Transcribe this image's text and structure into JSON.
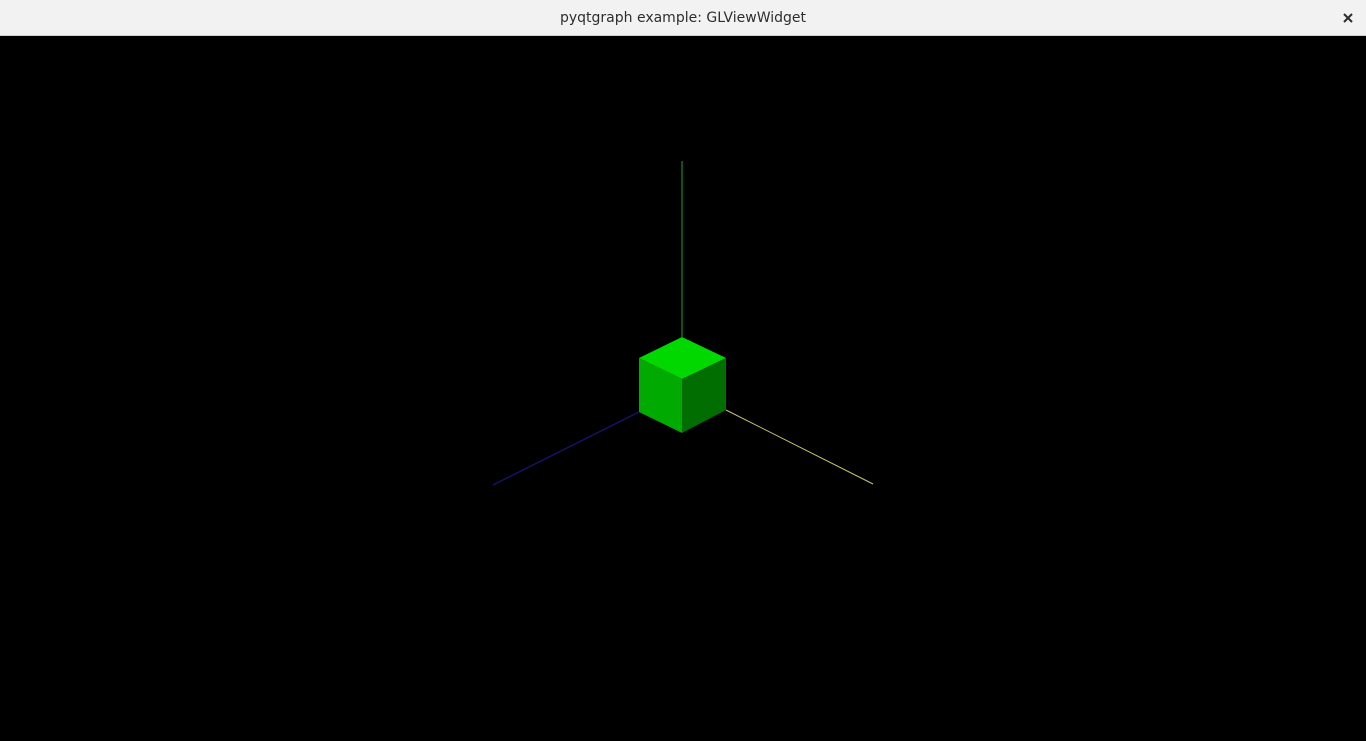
{
  "window": {
    "title": "pyqtgraph example: GLViewWidget",
    "close_icon": "close-icon"
  },
  "scene": {
    "background": "#000000",
    "axes": {
      "up_color": "#1fa01f",
      "left_color": "#14146e",
      "right_color": "#c8c86e"
    },
    "cube": {
      "top_color": "#00d800",
      "front_color": "#00aa00",
      "side_color": "#006e00"
    }
  }
}
